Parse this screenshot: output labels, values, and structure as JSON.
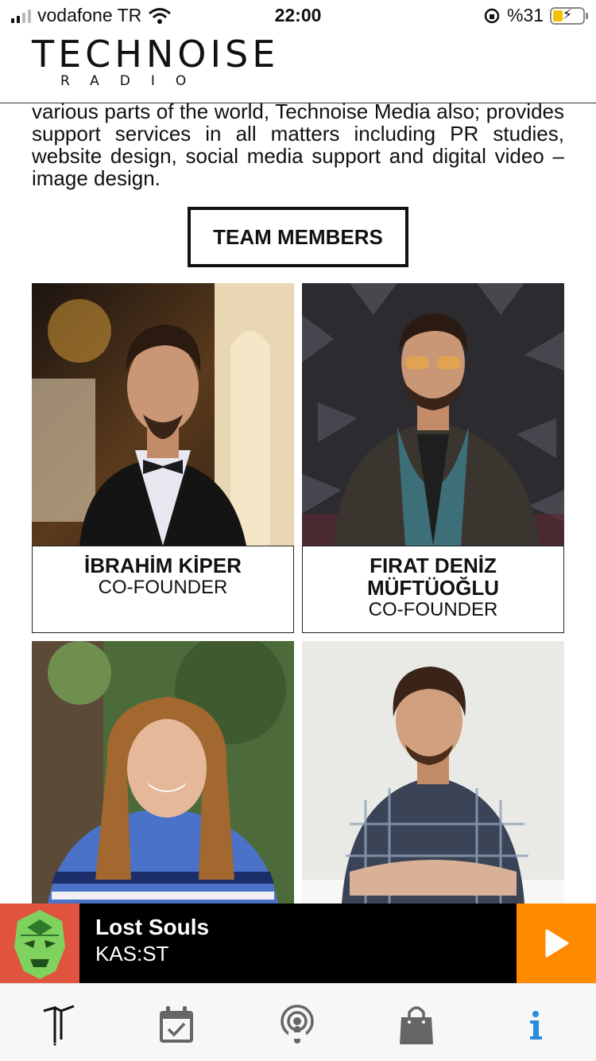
{
  "status_bar": {
    "carrier": "vodafone TR",
    "time": "22:00",
    "battery_text": "%31"
  },
  "header": {
    "logo_main": "TECHNOISE",
    "logo_sub": "RADIO"
  },
  "intro_text": "various parts of the world, Technoise Media also; provides support services in all matters including PR studies, website design, social media support and digital video – image design.",
  "team_button_label": "TEAM MEMBERS",
  "team": [
    {
      "name": "İBRAHİM KİPER",
      "role": "CO-FOUNDER"
    },
    {
      "name": "FIRAT DENİZ MÜFTÜOĞLU",
      "role": "CO-FOUNDER"
    },
    {
      "name": "",
      "role": ""
    },
    {
      "name": "",
      "role": ""
    }
  ],
  "player": {
    "title": "Lost Souls",
    "artist": "KAS:ST"
  },
  "tabs": [
    {
      "icon": "technoise-logo-icon"
    },
    {
      "icon": "calendar-check-icon"
    },
    {
      "icon": "podcast-icon"
    },
    {
      "icon": "shopping-bag-icon"
    },
    {
      "icon": "info-icon",
      "active": true
    }
  ],
  "colors": {
    "accent_orange": "#ff8a00",
    "art_red": "#e0543f",
    "active_tab": "#2a8be0",
    "inactive_tab": "#555555"
  }
}
